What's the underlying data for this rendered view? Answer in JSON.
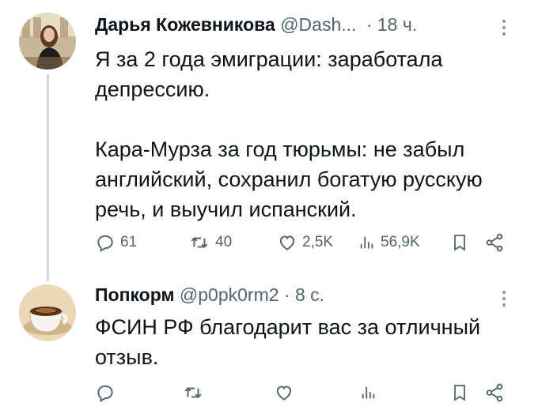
{
  "tweet1": {
    "name": "Дарья Кожевникова",
    "handle": "@Dash...",
    "dot": "·",
    "time": "18 ч.",
    "text": "Я за 2 года эмиграции: заработала\nдепрессию.\n\nКара-Мурза за год тюрьмы: не забыл\nанглийский, сохранил богатую русскую\nречь, и выучил испанский.",
    "replies": "61",
    "retweets": "40",
    "likes": "2,5K",
    "views": "56,9K"
  },
  "tweet2": {
    "name": "Попкорм",
    "handle": "@p0pk0rm2",
    "dot": "·",
    "time": "8 с.",
    "text": "ФСИН РФ благодарит вас за отличный\nотзыв."
  },
  "icons": [
    "reply-icon",
    "retweet-icon",
    "like-icon",
    "views-icon",
    "bookmark-icon",
    "share-icon",
    "more-icon"
  ],
  "colors": {
    "icon": "#536471",
    "text": "#0f1419",
    "thread": "#cfd9de"
  }
}
